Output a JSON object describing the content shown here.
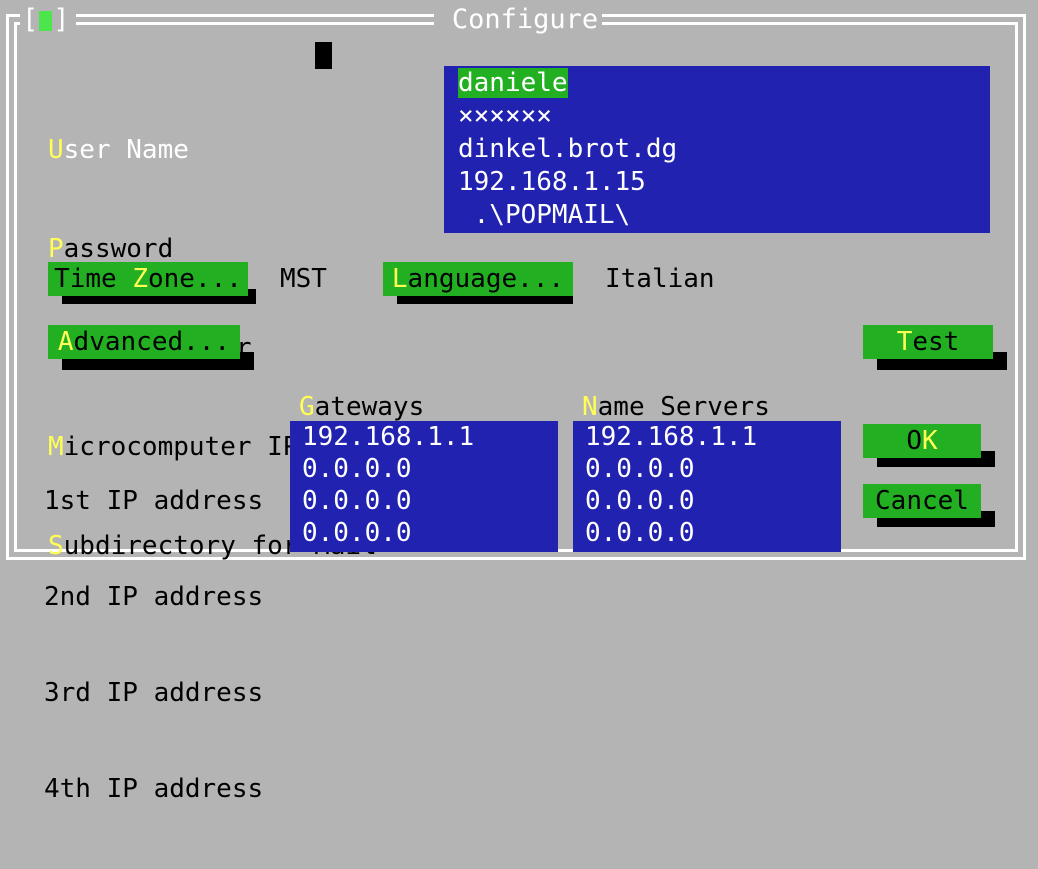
{
  "window": {
    "title": "Configure",
    "close_button": "[■]",
    "close_icon": "close-icon",
    "bg_color": "#b4b4b4",
    "frame_color": "#ffffff"
  },
  "colors": {
    "panel_blue": "#2222b0",
    "button_green": "#22b022",
    "accel_yellow": "#ffff55",
    "selection_green": "#22b022",
    "text_black": "#000000",
    "text_white": "#ffffff"
  },
  "form": {
    "fields": [
      {
        "accel": "U",
        "rest": "ser Name",
        "label": "User Name",
        "value": "daniele",
        "selected": true,
        "label_color": "#ffffff"
      },
      {
        "accel": "P",
        "rest": "assword",
        "label": "Password",
        "value": "××××××",
        "selected": false,
        "label_color": "#000000"
      },
      {
        "accel": "H",
        "rest": "ost Computer",
        "label": "Host Computer",
        "value": "dinkel.brot.dg",
        "selected": false,
        "label_color": "#000000"
      },
      {
        "accel": "M",
        "rest": "icrocomputer IP address",
        "label": "Microcomputer IP address",
        "value": "192.168.1.15",
        "selected": false,
        "label_color": "#000000"
      },
      {
        "accel": "S",
        "rest": "ubdirectory for Mail",
        "label": "Subdirectory for Mail",
        "value": " .\\POPMAIL\\",
        "selected": false,
        "label_color": "#000000"
      }
    ]
  },
  "buttons": {
    "time_zone": {
      "pre": "Time ",
      "accel": "Z",
      "post": "one...",
      "label": "Time Zone..."
    },
    "language": {
      "pre": "",
      "accel": "L",
      "post": "anguage...",
      "label": "Language..."
    },
    "advanced": {
      "pre": "",
      "accel": "A",
      "post": "dvanced...",
      "label": "Advanced..."
    },
    "test": {
      "pre": "",
      "accel": "T",
      "post": "est",
      "label": "Test"
    },
    "ok": {
      "pre": "O",
      "accel": "K",
      "post": "",
      "label": "OK"
    },
    "cancel": {
      "pre": "Cancel",
      "accel": "",
      "post": "",
      "label": "Cancel"
    }
  },
  "values": {
    "time_zone": "MST",
    "language": "Italian"
  },
  "network": {
    "columns": [
      {
        "accel": "G",
        "rest": "ateways",
        "label": "Gateways"
      },
      {
        "accel": "N",
        "rest": "ame Servers",
        "label": "Name Servers"
      }
    ],
    "row_labels": [
      "1st IP address",
      "2nd IP address",
      "3rd IP address",
      "4th IP address"
    ],
    "gateways": [
      "192.168.1.1",
      "0.0.0.0",
      "0.0.0.0",
      "0.0.0.0"
    ],
    "name_servers": [
      "192.168.1.1",
      "0.0.0.0",
      "0.0.0.0",
      "0.0.0.0"
    ]
  }
}
